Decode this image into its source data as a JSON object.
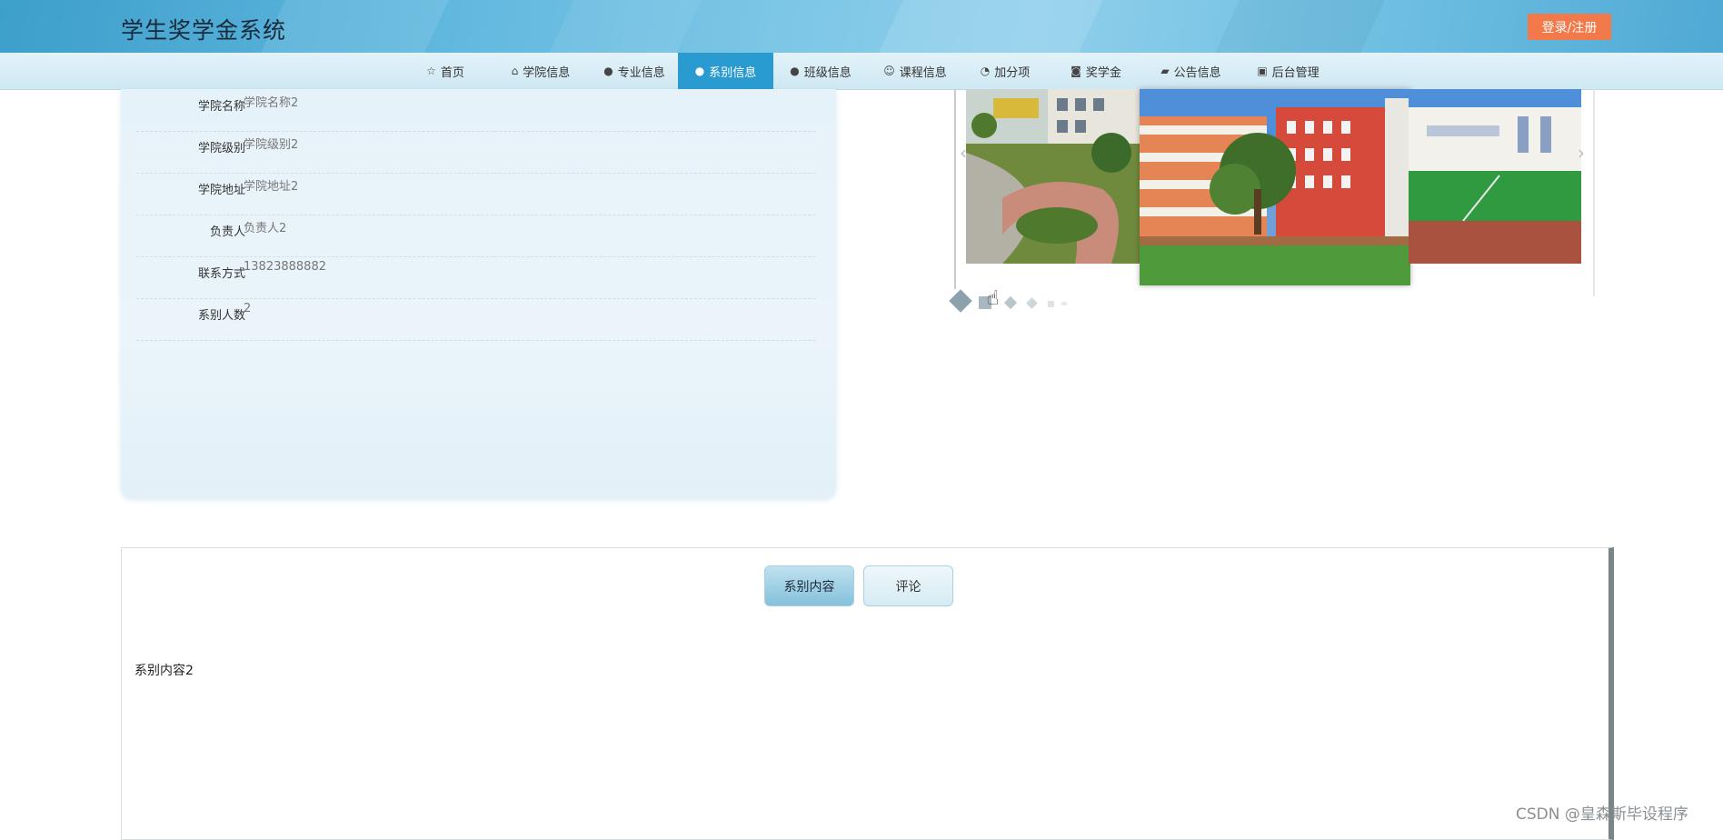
{
  "header": {
    "title": "学生奖学金系统",
    "login_label": "登录/注册",
    "accent": "#f27a4a"
  },
  "nav": {
    "active_color": "#2a9bd0",
    "items": [
      {
        "icon": "star-icon",
        "glyph": "☆",
        "label": "首页"
      },
      {
        "icon": "building-icon",
        "glyph": "⌂",
        "label": "学院信息"
      },
      {
        "icon": "info-circle-icon",
        "glyph": "●",
        "label": "专业信息"
      },
      {
        "icon": "question-circle-icon",
        "glyph": "●",
        "label": "系别信息"
      },
      {
        "icon": "info-icon",
        "glyph": "●",
        "label": "班级信息"
      },
      {
        "icon": "smile-icon",
        "glyph": "☺",
        "label": "课程信息"
      },
      {
        "icon": "dashboard-icon",
        "glyph": "◔",
        "label": "加分项"
      },
      {
        "icon": "camera-icon",
        "glyph": "◙",
        "label": "奖学金"
      },
      {
        "icon": "car-icon",
        "glyph": "▰",
        "label": "公告信息"
      },
      {
        "icon": "gift-icon",
        "glyph": "▣",
        "label": "后台管理"
      }
    ]
  },
  "detail": {
    "fields": [
      {
        "label": "学院名称",
        "value": "学院名称2"
      },
      {
        "label": "学院级别",
        "value": "学院级别2"
      },
      {
        "label": "学院地址",
        "value": "学院地址2"
      },
      {
        "label": "负责人",
        "value": "负责人2"
      },
      {
        "label": "联系方式",
        "value": "13823888882"
      },
      {
        "label": "系别人数",
        "value": "2"
      }
    ]
  },
  "carousel": {
    "prev_glyph": "‹",
    "next_glyph": "›",
    "active_index": 0,
    "dot_count": 6
  },
  "tabs": {
    "items": [
      {
        "label": "系别内容",
        "active": true
      },
      {
        "label": "评论",
        "active": false
      }
    ],
    "content": "系别内容2"
  },
  "watermark": "CSDN @皇森斯毕设程序"
}
